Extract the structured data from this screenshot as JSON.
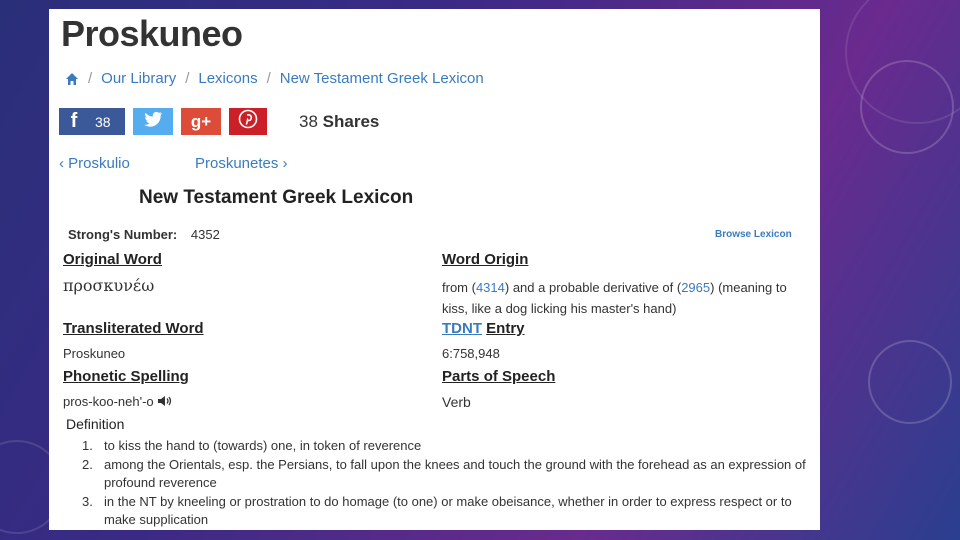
{
  "page": {
    "title": "Proskuneo"
  },
  "breadcrumb": {
    "items": [
      "Our Library",
      "Lexicons",
      "New Testament Greek Lexicon"
    ],
    "separator": "/"
  },
  "social": {
    "facebook_count": "38",
    "shares_count": "38",
    "shares_label": "Shares",
    "icons": [
      "facebook-icon",
      "twitter-icon",
      "google-plus-icon",
      "pinterest-icon"
    ],
    "colors": {
      "facebook": "#3b5998",
      "twitter": "#55acee",
      "google_plus": "#dd4b39",
      "pinterest": "#cb2027"
    }
  },
  "nav": {
    "prev": "‹ Proskulio",
    "next": "Proskunetes ›"
  },
  "lexicon": {
    "heading": "New Testament Greek Lexicon",
    "strongs_label": "Strong's Number:",
    "strongs_value": "4352",
    "browse_label": "Browse Lexicon",
    "original_word_label": "Original Word",
    "original_word_value": "προσκυνέω",
    "word_origin_label": "Word Origin",
    "word_origin_prefix": "from (",
    "word_origin_ref1": "4314",
    "word_origin_mid": ") and a probable derivative of (",
    "word_origin_ref2": "2965",
    "word_origin_suffix": ") (meaning to",
    "word_origin_line2": "kiss, like a dog licking his master's hand)",
    "transliterated_label": "Transliterated Word",
    "transliterated_value": "Proskuneo",
    "tdnt_link": "TDNT",
    "tdnt_label": "Entry",
    "tdnt_value": "6:758,948",
    "phonetic_label": "Phonetic Spelling",
    "phonetic_value": "pros-koo-neh'-o",
    "parts_label": "Parts of Speech",
    "parts_value": "Verb",
    "definition_label": "Definition",
    "definitions": [
      {
        "num": "1.",
        "text": "to kiss the hand to (towards) one, in token of reverence"
      },
      {
        "num": "2.",
        "text": "among the Orientals, esp. the Persians, to fall upon the knees and touch the ground with the forehead as an expression of profound reverence"
      },
      {
        "num": "3.",
        "text": "in the NT by kneeling or prostration to do homage (to one) or make obeisance, whether in order to express respect or to make supplication"
      }
    ]
  }
}
